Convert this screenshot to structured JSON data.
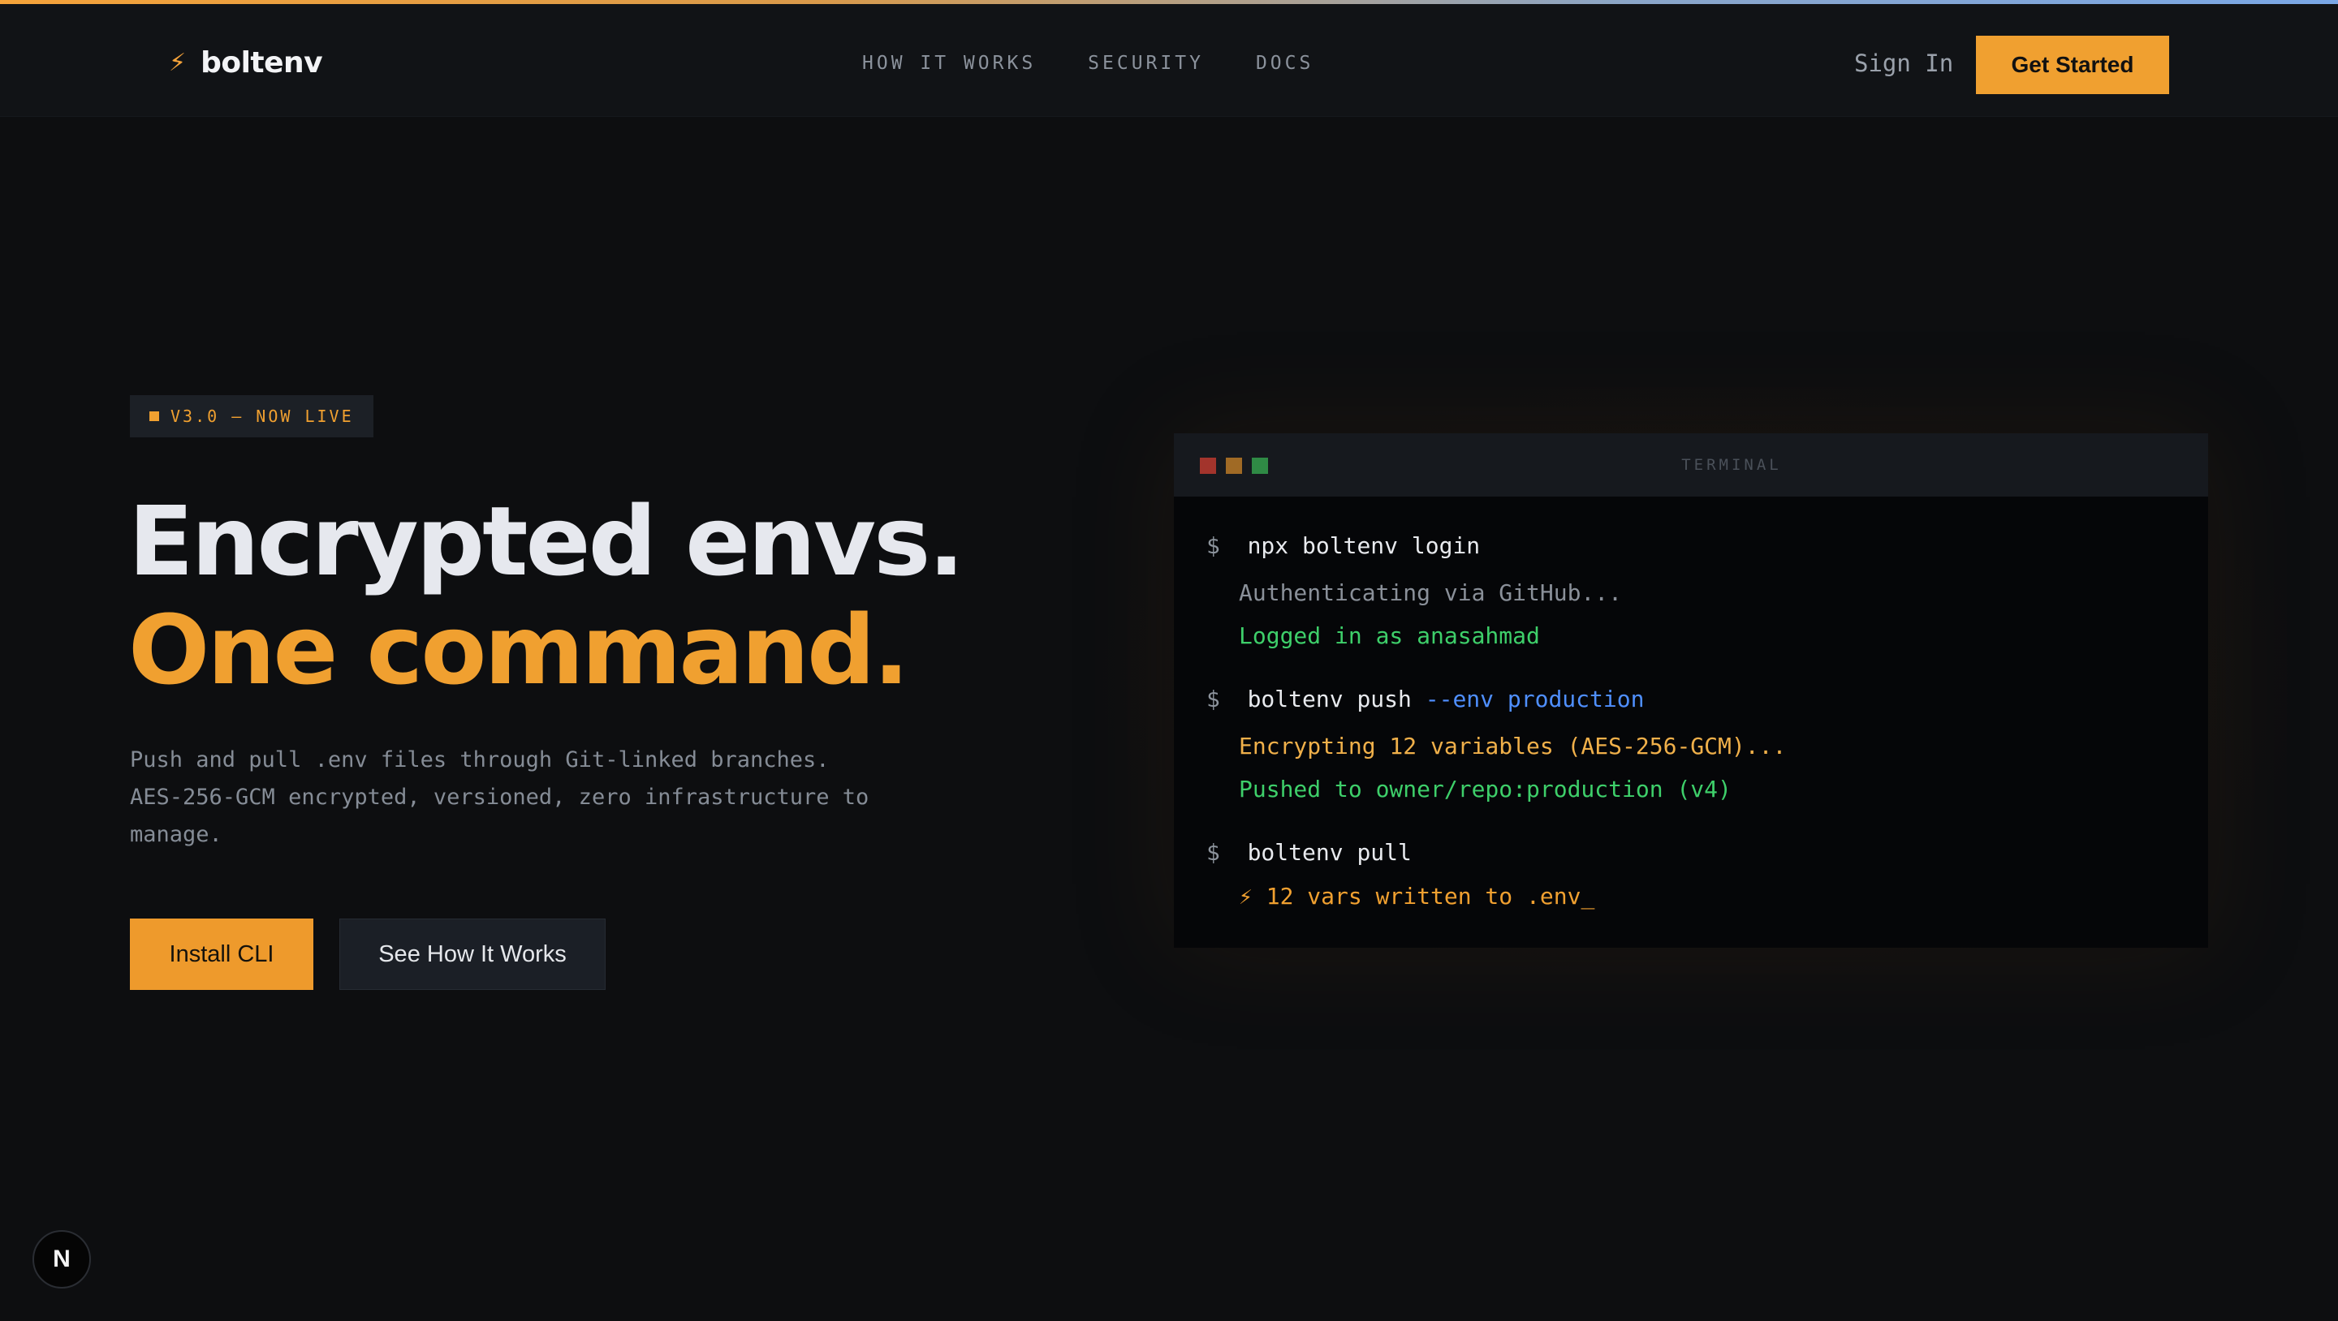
{
  "brand": {
    "name": "boltenv",
    "icon": "bolt-icon"
  },
  "nav": {
    "links": [
      "HOW IT WORKS",
      "SECURITY",
      "DOCS"
    ],
    "sign_in": "Sign In",
    "cta": "Get Started"
  },
  "hero": {
    "badge": "V3.0 — NOW LIVE",
    "title_line1": "Encrypted envs.",
    "title_line2": "One command.",
    "description": "Push and pull .env files through Git-linked branches. AES-256-GCM encrypted, versioned, zero infrastructure to manage.",
    "primary_button": "Install CLI",
    "secondary_button": "See How It Works"
  },
  "terminal": {
    "title": "TERMINAL",
    "prompt": "$",
    "cmd1": "npx boltenv login",
    "out1a": "Authenticating via GitHub...",
    "out1b": "Logged in as anasahmad",
    "cmd2": "boltenv push",
    "cmd2_flag": "--env production",
    "out2a": "Encrypting 12 variables (AES-256-GCM)...",
    "out2b": "Pushed to owner/repo:production (v4)",
    "cmd3": "boltenv pull",
    "out3": "⚡ 12 vars written to .env",
    "cursor": "_"
  },
  "colors": {
    "accent": "#f0a030",
    "success": "#3ecf6a",
    "flag": "#4f8fff",
    "background": "#0b0c0e"
  },
  "dev_badge": {
    "letter": "N"
  }
}
